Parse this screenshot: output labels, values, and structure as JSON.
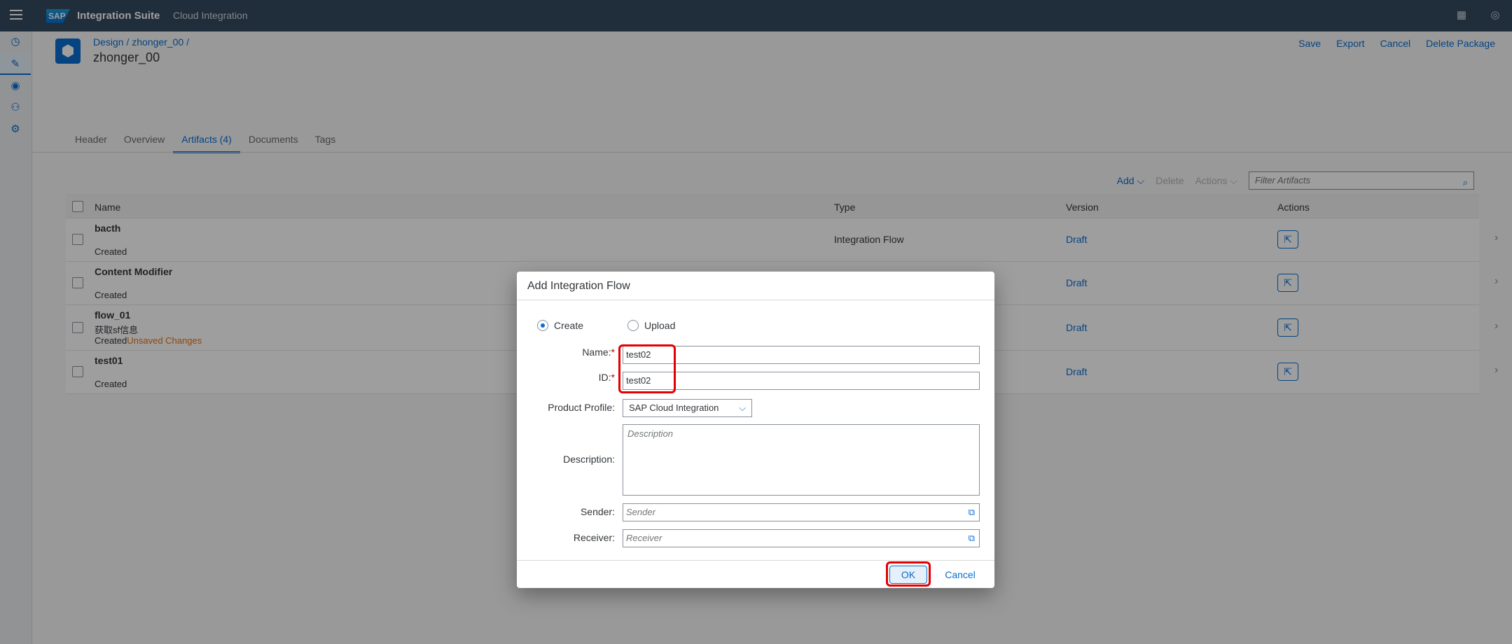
{
  "shell": {
    "brand": "SAP",
    "app_title": "Integration Suite",
    "sub_title": "Cloud Integration"
  },
  "header": {
    "breadcrumb": "Design / zhonger_00 /",
    "title": "zhonger_00",
    "actions": {
      "save": "Save",
      "export": "Export",
      "cancel": "Cancel",
      "delete": "Delete Package"
    }
  },
  "tabs": [
    "Header",
    "Overview",
    "Artifacts (4)",
    "Documents",
    "Tags"
  ],
  "toolbar": {
    "add": "Add",
    "delete": "Delete",
    "actions": "Actions",
    "filter_placeholder": "Filter Artifacts"
  },
  "table": {
    "columns": {
      "name": "Name",
      "type": "Type",
      "version": "Version",
      "actions": "Actions"
    },
    "rows": [
      {
        "name": "bacth",
        "desc": "",
        "status": "Created",
        "warn": "",
        "type": "Integration Flow",
        "version": "Draft"
      },
      {
        "name": "Content Modifier",
        "desc": "",
        "status": "Created",
        "warn": "",
        "type": "",
        "version": "Draft"
      },
      {
        "name": "flow_01",
        "desc": "获取sf信息",
        "status": "Created",
        "warn": "Unsaved Changes",
        "type": "",
        "version": "Draft"
      },
      {
        "name": "test01",
        "desc": "",
        "status": "Created",
        "warn": "",
        "type": "",
        "version": "Draft"
      }
    ]
  },
  "dialog": {
    "title": "Add Integration Flow",
    "radio_create": "Create",
    "radio_upload": "Upload",
    "name_label": "Name:",
    "name_value": "test02",
    "id_label": "ID:",
    "id_value": "test02",
    "profile_label": "Product Profile:",
    "profile_value": "SAP Cloud Integration",
    "description_label": "Description:",
    "description_placeholder": "Description",
    "sender_label": "Sender:",
    "sender_placeholder": "Sender",
    "receiver_label": "Receiver:",
    "receiver_placeholder": "Receiver",
    "ok": "OK",
    "cancel": "Cancel",
    "required_mark": "*"
  },
  "colors": {
    "brand": "#0a6ed1",
    "shell": "#354a5f",
    "highlight": "#e30000",
    "warning": "#e9730c"
  }
}
